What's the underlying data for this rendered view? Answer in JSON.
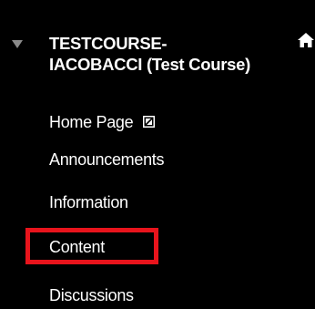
{
  "course": {
    "title_line1": "TESTCOURSE-",
    "title_line2": "IACOBACCI (Test Course)",
    "toggle_icon": "triangle-down-icon",
    "home_icon": "home-icon"
  },
  "menu": {
    "items": [
      {
        "label": "Home Page",
        "icon": "unavailable-icon"
      },
      {
        "label": "Announcements"
      },
      {
        "label": "Information"
      },
      {
        "label": "Content",
        "highlighted": true
      },
      {
        "label": "Discussions"
      }
    ]
  },
  "colors": {
    "background": "#000000",
    "text": "#ffffff",
    "toggle": "#8a8a8a",
    "highlight": "#e8141c"
  }
}
